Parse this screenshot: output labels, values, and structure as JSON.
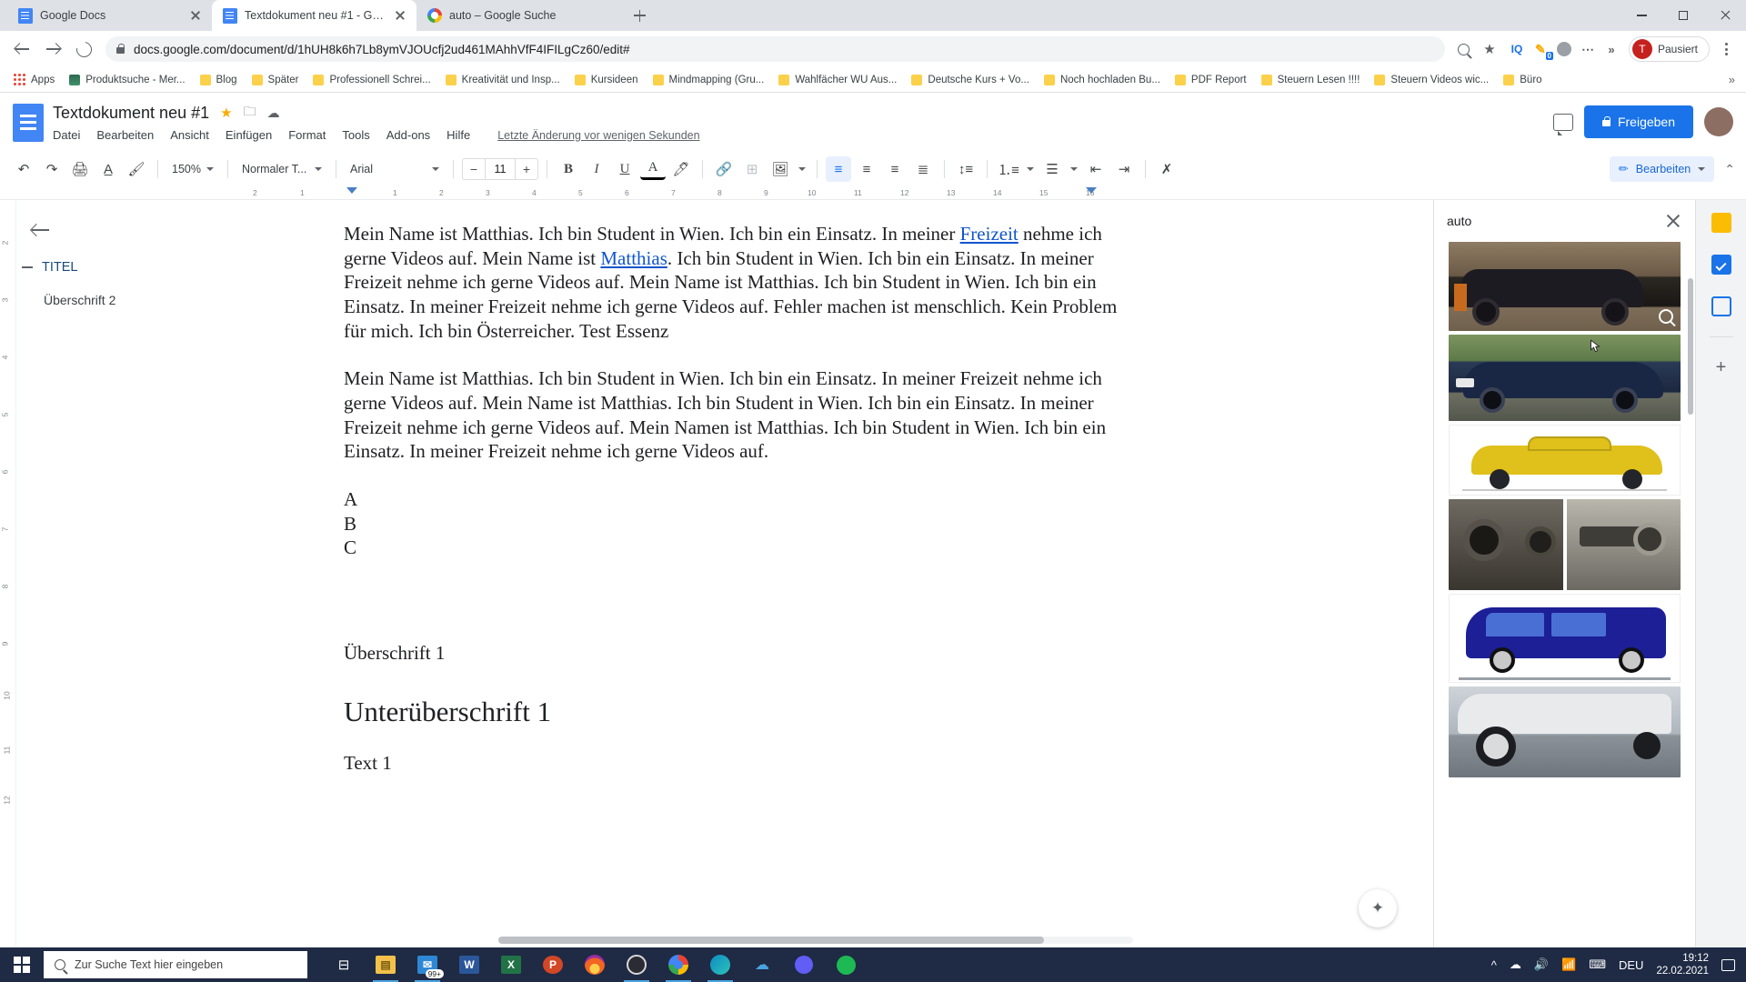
{
  "browser": {
    "tabs": [
      {
        "title": "Google Docs",
        "icon": "google-docs-icon",
        "active": false
      },
      {
        "title": "Textdokument neu #1 - Google D",
        "icon": "google-docs-icon",
        "active": true
      },
      {
        "title": "auto – Google Suche",
        "icon": "google-icon",
        "active": false
      }
    ],
    "new_tab_label": "+",
    "url": "docs.google.com/document/d/1hUH8k6h7Lb8ymVJOUcfj2ud461MAhhVfF4IFILgCz60/edit#",
    "profile_name": "Pausiert",
    "profile_initial": "T",
    "extension_badge": "0",
    "bookmarks": [
      "Apps",
      "Produktsuche - Mer...",
      "Blog",
      "Später",
      "Professionell Schrei...",
      "Kreativität und Insp...",
      "Kursideen",
      "Mindmapping  (Gru...",
      "Wahlfächer WU Aus...",
      "Deutsche Kurs + Vo...",
      "Noch hochladen Bu...",
      "PDF Report",
      "Steuern Lesen !!!!",
      "Steuern Videos wic...",
      "Büro"
    ],
    "bookmark_overflow": "»"
  },
  "docs": {
    "title": "Textdokument neu #1",
    "star_icon": "star-icon",
    "move_icon": "move-to-folder-icon",
    "cloud_icon": "cloud-saved-icon",
    "menu": [
      "Datei",
      "Bearbeiten",
      "Ansicht",
      "Einfügen",
      "Format",
      "Tools",
      "Add-ons",
      "Hilfe"
    ],
    "last_edit": "Letzte Änderung vor wenigen Sekunden",
    "comment_icon": "comment-icon",
    "share_label": "Freigeben",
    "account_initial": "",
    "toolbar": {
      "zoom": "150%",
      "style": "Normaler T...",
      "font": "Arial",
      "font_size": "11",
      "minus": "−",
      "plus": "+",
      "bold": "B",
      "italic": "I",
      "underline": "U",
      "text_color": "A",
      "mode_label": "Bearbeiten"
    },
    "outline": {
      "heading": "TITEL",
      "items": [
        "Überschrift 2"
      ]
    },
    "ruler_marks": [
      "2",
      "1",
      "1",
      "2",
      "3",
      "4",
      "5",
      "6",
      "7",
      "8",
      "9",
      "10",
      "11",
      "12",
      "13",
      "14",
      "15",
      "16"
    ],
    "vruler_marks": [
      "2",
      "3",
      "4",
      "5",
      "6",
      "7",
      "8",
      "9",
      "10",
      "11",
      "12"
    ],
    "content": {
      "paragraph1_a": "Mein Name ist Matthias. Ich bin Student in Wien. Ich bin ein Einsatz. In meiner ",
      "paragraph1_link1": "Freizeit",
      "paragraph1_b": " nehme ich gerne Videos auf. Mein Name ist ",
      "paragraph1_link2": "Matthias",
      "paragraph1_c": ". Ich bin Student in Wien. Ich bin ein Einsatz. In meiner Freizeit nehme ich gerne Videos auf. Mein Name ist Matthias. Ich bin Student in Wien. Ich bin ein Einsatz. In meiner Freizeit nehme ich gerne Videos auf. Fehler machen ist menschlich. Kein Problem für mich. Ich bin Österreicher. Test Essenz",
      "paragraph2": "Mein Name ist Matthias. Ich bin Student in Wien. Ich bin ein Einsatz. In meiner Freizeit nehme ich gerne Videos auf. Mein Name ist Matthias. Ich bin Student in Wien. Ich bin ein Einsatz. In meiner Freizeit nehme ich gerne Videos auf. Mein Namen ist Matthias. Ich bin Student in Wien. Ich bin ein Einsatz. In meiner Freizeit nehme ich gerne Videos auf.",
      "list": [
        "A",
        "B",
        "C"
      ],
      "heading1": "Überschrift 1",
      "heading2": "Unterüberschrift 1",
      "text1": "Text 1"
    },
    "explore_icon": "explore-icon"
  },
  "side_panel": {
    "query": "auto",
    "close_icon": "close-icon",
    "magnify_icon": "magnify-icon",
    "results": [
      {
        "name": "vintage-black-car-photo"
      },
      {
        "name": "blue-sports-car-photo"
      },
      {
        "name": "yellow-classic-car-illustration"
      },
      {
        "name": "vintage-car-chassis-photo-pair"
      },
      {
        "name": "blue-van-illustration"
      },
      {
        "name": "white-sedan-photo"
      }
    ]
  },
  "right_rail": {
    "items": [
      {
        "name": "google-keep-icon"
      },
      {
        "name": "google-calendar-icon"
      },
      {
        "name": "google-tasks-icon"
      },
      {
        "name": "add-addon-icon"
      }
    ]
  },
  "taskbar": {
    "search_placeholder": "Zur Suche Text hier eingeben",
    "task_view_icon": "task-view-icon",
    "apps": [
      {
        "name": "file-explorer-icon",
        "label": ""
      },
      {
        "name": "mail-icon",
        "label": "99+"
      },
      {
        "name": "word-icon",
        "label": "W"
      },
      {
        "name": "excel-icon",
        "label": "X"
      },
      {
        "name": "powerpoint-icon",
        "label": "P"
      },
      {
        "name": "firefox-icon",
        "label": ""
      },
      {
        "name": "obs-icon",
        "label": ""
      },
      {
        "name": "chrome-icon",
        "label": ""
      },
      {
        "name": "edge-icon",
        "label": ""
      },
      {
        "name": "onedrive-icon",
        "label": ""
      },
      {
        "name": "loom-icon",
        "label": ""
      },
      {
        "name": "spotify-icon",
        "label": ""
      }
    ],
    "tray": {
      "chevron": "^",
      "onedrive_icon": "onedrive-tray-icon",
      "volume_icon": "volume-icon",
      "wifi_icon": "wifi-icon",
      "keyboard_icon": "keyboard-icon",
      "language": "DEU",
      "time": "19:12",
      "date": "22.02.2021",
      "notification_icon": "notification-icon"
    }
  },
  "colors": {
    "chrome_frame": "#dee1e6",
    "accent_blue": "#1a73e8",
    "docs_blue": "#4285f4",
    "taskbar": "#1f2a44"
  }
}
